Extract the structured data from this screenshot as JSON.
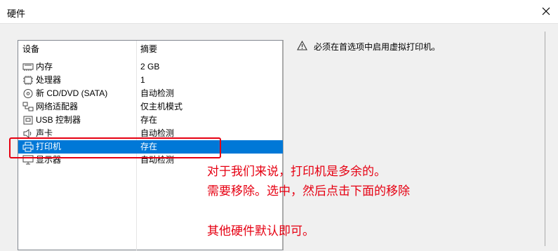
{
  "window": {
    "title": "硬件"
  },
  "devices": {
    "header_device": "设备",
    "header_summary": "摘要",
    "rows": [
      {
        "name": "内存",
        "summary": "2 GB",
        "icon": "memory-icon"
      },
      {
        "name": "处理器",
        "summary": "1",
        "icon": "processor-icon"
      },
      {
        "name": "新 CD/DVD (SATA)",
        "summary": "自动检测",
        "icon": "cd-dvd-icon"
      },
      {
        "name": "网络适配器",
        "summary": "仅主机模式",
        "icon": "network-adapter-icon"
      },
      {
        "name": "USB 控制器",
        "summary": "存在",
        "icon": "usb-controller-icon"
      },
      {
        "name": "声卡",
        "summary": "自动检测",
        "icon": "sound-card-icon"
      },
      {
        "name": "打印机",
        "summary": "存在",
        "icon": "printer-icon",
        "selected": true
      },
      {
        "name": "显示器",
        "summary": "自动检测",
        "icon": "display-icon"
      }
    ]
  },
  "details": {
    "warning": "必须在首选项中启用虚拟打印机。"
  },
  "annotation": {
    "line1": "对于我们来说，打印机是多余的。",
    "line2": "需要移除。选中，然后点击下面的移除",
    "line3": "其他硬件默认即可。"
  },
  "colors": {
    "selection": "#0078d7",
    "annotation_red": "#e60012"
  }
}
